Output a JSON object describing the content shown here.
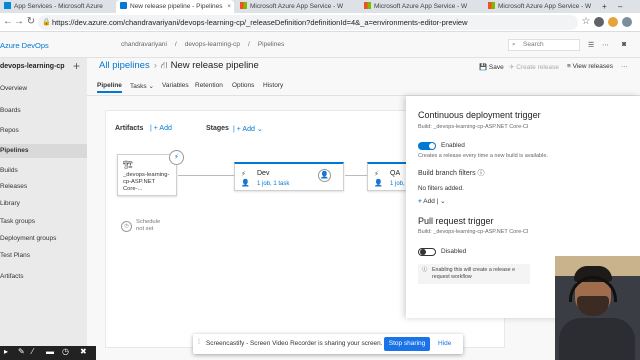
{
  "browser": {
    "tabs": [
      {
        "label": "App Services - Microsoft Azure",
        "icon": "azure-icon",
        "active": false
      },
      {
        "label": "New release pipeline - Pipelines",
        "icon": "devops-icon",
        "active": true
      },
      {
        "label": "Microsoft Azure App Service - W",
        "icon": "microsoft-icon",
        "active": false
      },
      {
        "label": "Microsoft Azure App Service - W",
        "icon": "microsoft-icon",
        "active": false
      },
      {
        "label": "Microsoft Azure App Service - W",
        "icon": "microsoft-icon",
        "active": false
      }
    ],
    "url": "https://dev.azure.com/chandravariyani/devops-learning-cp/_releaseDefinition?definitionId=4&_a=environments-editor-preview"
  },
  "header": {
    "brand": "Azure DevOps",
    "breadcrumb": [
      "chandravariyani",
      "/",
      "devops-learning-cp",
      "/",
      "Pipelines"
    ],
    "search_placeholder": "Search"
  },
  "sidebar": {
    "project": "devops-learning-cp",
    "items": [
      {
        "label": "Overview"
      },
      {
        "label": "Boards"
      },
      {
        "label": "Repos"
      },
      {
        "label": "Pipelines",
        "active": true
      },
      {
        "label": "Builds"
      },
      {
        "label": "Releases"
      },
      {
        "label": "Library"
      },
      {
        "label": "Task groups"
      },
      {
        "label": "Deployment groups"
      },
      {
        "label": "Test Plans"
      },
      {
        "label": "Artifacts"
      }
    ]
  },
  "main": {
    "all_pipelines": "All pipelines",
    "separator": "›",
    "pipeline_name": "New release pipeline",
    "toolbar": {
      "save": "Save",
      "create_release": "Create release",
      "view_releases": "View releases",
      "more": "···"
    },
    "tabs": [
      "Pipeline",
      "Tasks",
      "Variables",
      "Retention",
      "Options",
      "History"
    ],
    "artifacts_label": "Artifacts",
    "artifacts_add": "Add",
    "stages_label": "Stages",
    "stages_add": "Add",
    "artifact_name": "_devops-learning-cp-ASP.NET Core-...",
    "schedule_text": [
      "Schedule",
      "not set"
    ],
    "stages": [
      {
        "name": "Dev",
        "info": "1 job, 1 task"
      },
      {
        "name": "QA",
        "info": "1 job, 1 task"
      }
    ]
  },
  "panel": {
    "cd_title": "Continuous deployment trigger",
    "cd_build": "Build: _devops-learning-cp-ASP.NET Core-CI",
    "enabled_label": "Enabled",
    "enabled_desc": "Creates a release every time a new build is available.",
    "branch_filters": "Build branch filters",
    "no_filters": "No filters added.",
    "add": "Add",
    "pr_title": "Pull request trigger",
    "pr_build": "Build: _devops-learning-cp-ASP.NET Core-CI",
    "disabled_label": "Disabled",
    "info_text": [
      "Enabling this will create a release e",
      "request workflow"
    ]
  },
  "sharebar": {
    "message": "Screencastify - Screen Video Recorder is sharing your screen.",
    "stop": "Stop sharing",
    "hide": "Hide"
  },
  "colors": {
    "accent": "#0078d4",
    "share_blue": "#1a73e8"
  }
}
